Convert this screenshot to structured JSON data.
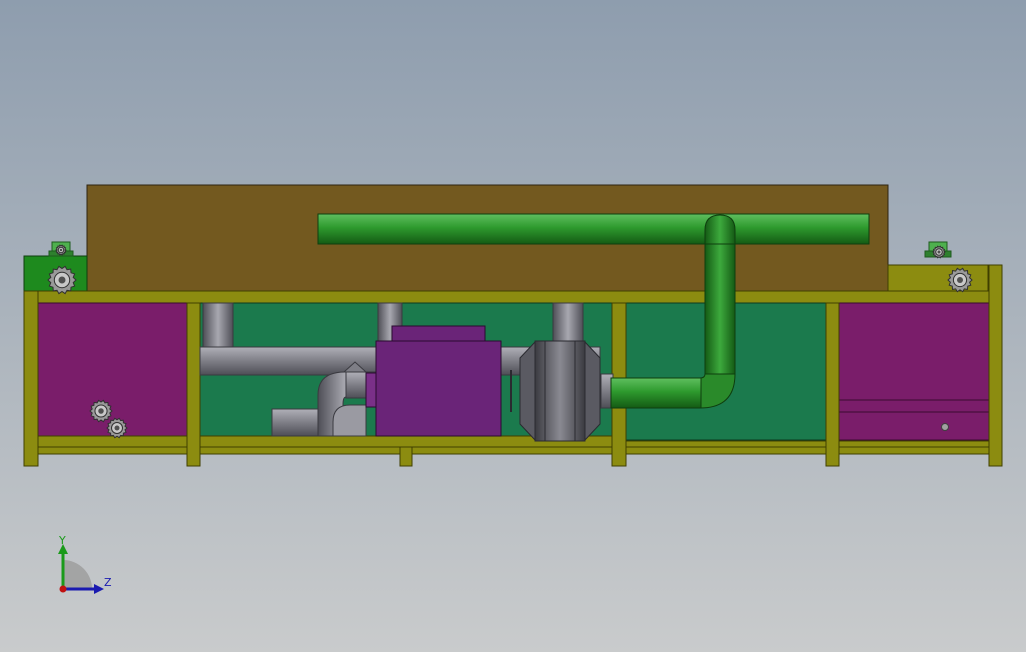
{
  "scene": {
    "view": "side elevation",
    "background": {
      "top": "#8E9DAE",
      "bottom": "#C9CBCC"
    }
  },
  "colors": {
    "frame": "#8C8C10",
    "frame_edge": "#3F3F00",
    "enclosure": "#73591F",
    "enclosure_edge": "#2E2410",
    "panel_magenta": "#7A1D6A",
    "panel_green": "#1B7A4D",
    "pipe_green": "#2C8C2C",
    "pipe_gray": "#7E7E86",
    "purple_box": "#6A2478",
    "motor_green": "#3EA03E",
    "gear_gray": "#8A8A8A"
  },
  "axis_triad": {
    "y_label": "Y",
    "z_label": "Z",
    "y_color": "#1A9A1A",
    "z_color": "#1A1AB0",
    "origin_color": "#C01010"
  }
}
